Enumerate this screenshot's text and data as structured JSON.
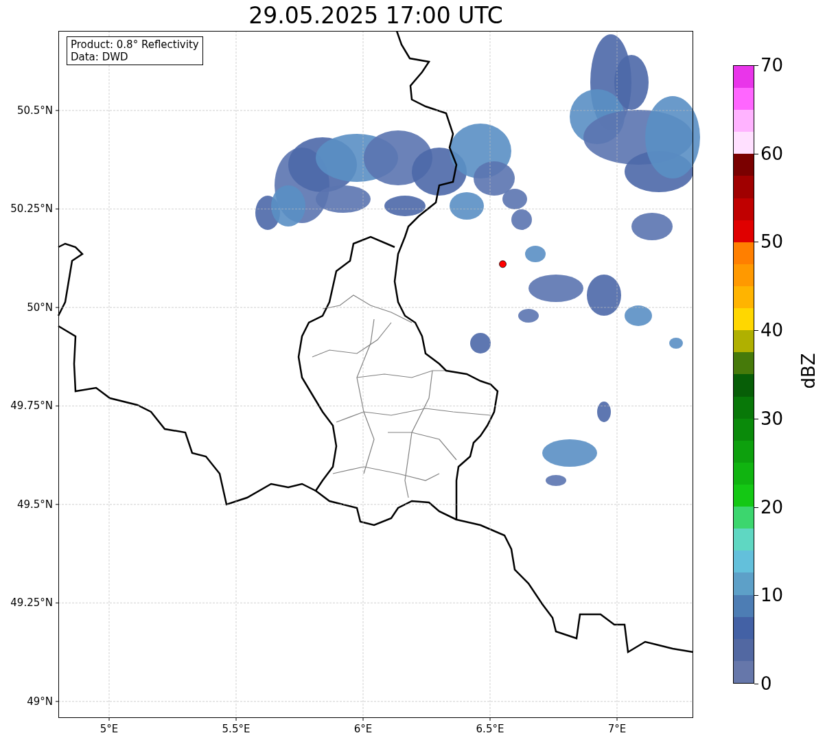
{
  "title": "29.05.2025 17:00 UTC",
  "info_box": {
    "lines": [
      "Product: 0.8° Reflectivity",
      "Data: DWD"
    ]
  },
  "map": {
    "chart_data": {
      "type": "scatter",
      "grid": true,
      "xlim": [
        4.8,
        7.3
      ],
      "ylim": [
        48.958,
        50.702
      ],
      "xticks": [
        {
          "value": 5,
          "label": "5°E"
        },
        {
          "value": 5.5,
          "label": "5.5°E"
        },
        {
          "value": 6,
          "label": "6°E"
        },
        {
          "value": 6.5,
          "label": "6.5°E"
        },
        {
          "value": 7,
          "label": "7°E"
        }
      ],
      "yticks": [
        {
          "value": 49,
          "label": "49°N"
        },
        {
          "value": 49.25,
          "label": "49.25°N"
        },
        {
          "value": 49.5,
          "label": "49.5°N"
        },
        {
          "value": 49.75,
          "label": "49.75°N"
        },
        {
          "value": 50,
          "label": "50°N"
        },
        {
          "value": 50.25,
          "label": "50.25°N"
        },
        {
          "value": 50.5,
          "label": "50.5°N"
        }
      ],
      "x": [
        6.55
      ],
      "series": [
        {
          "color": "#ff0000",
          "values": [
            50.11
          ]
        }
      ]
    }
  },
  "colorbar": {
    "label": "dBZ",
    "ticks": [
      "70",
      "60",
      "50",
      "40",
      "30",
      "20",
      "10",
      "0"
    ],
    "segments": [
      {
        "color": "#6677aa"
      },
      {
        "color": "#5268a2"
      },
      {
        "color": "#4361a5"
      },
      {
        "color": "#4d7db4"
      },
      {
        "color": "#5da0c8"
      },
      {
        "color": "#63c0db"
      },
      {
        "color": "#5fd7c2"
      },
      {
        "color": "#3cd66e"
      },
      {
        "color": "#14c814"
      },
      {
        "color": "#10b410"
      },
      {
        "color": "#0da00d"
      },
      {
        "color": "#0a8a0a"
      },
      {
        "color": "#087808"
      },
      {
        "color": "#075e07"
      },
      {
        "color": "#467a0a"
      },
      {
        "color": "#b0b000"
      },
      {
        "color": "#ffd700"
      },
      {
        "color": "#ffb400"
      },
      {
        "color": "#ff9900"
      },
      {
        "color": "#ff7f00"
      },
      {
        "color": "#e00000"
      },
      {
        "color": "#c00000"
      },
      {
        "color": "#a00000"
      },
      {
        "color": "#7a0000"
      },
      {
        "color": "#ffe0ff"
      },
      {
        "color": "#ffb3ff"
      },
      {
        "color": "#ff66ff"
      },
      {
        "color": "#e935ea"
      }
    ]
  }
}
